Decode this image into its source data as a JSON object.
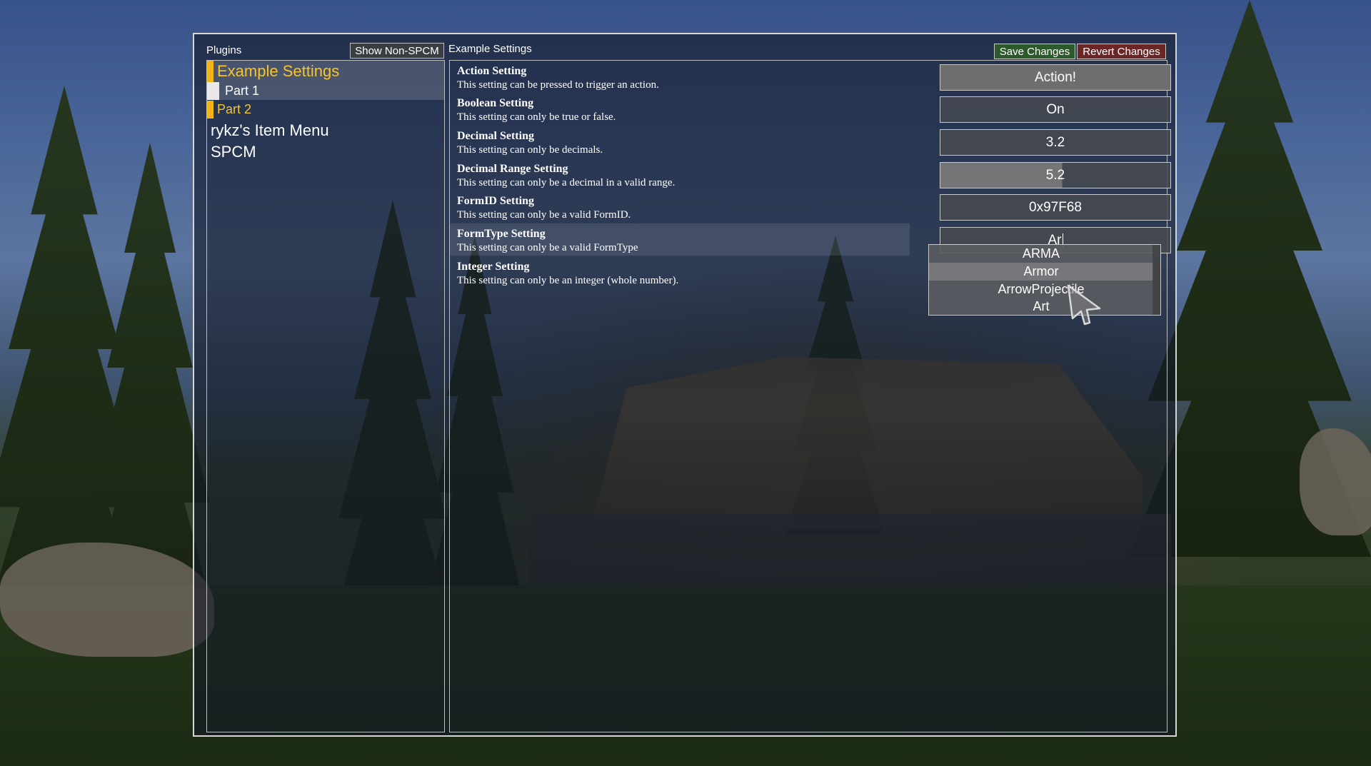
{
  "plugins_panel": {
    "title": "Plugins",
    "show_non_spcm_label": "Show Non-SPCM",
    "items": [
      {
        "label": "Example Settings",
        "selected": true
      },
      {
        "label": "Part 1"
      },
      {
        "label": "Part 2"
      },
      {
        "label": "rykz's Item Menu"
      },
      {
        "label": "SPCM"
      }
    ]
  },
  "settings_panel": {
    "title": "Example Settings",
    "save_label": "Save Changes",
    "revert_label": "Revert Changes",
    "settings": [
      {
        "name": "Action Setting",
        "description": "This setting can be pressed to trigger an action.",
        "value": "Action!"
      },
      {
        "name": "Boolean Setting",
        "description": "This setting can only be true or false.",
        "value": "On"
      },
      {
        "name": "Decimal Setting",
        "description": "This setting can only be decimals.",
        "value": "3.2"
      },
      {
        "name": "Decimal Range Setting",
        "description": "This setting can only be a decimal in a valid range.",
        "value": "5.2"
      },
      {
        "name": "FormID Setting",
        "description": "This setting can only be a valid FormID.",
        "value": "0x97F68"
      },
      {
        "name": "FormType Setting",
        "description": "This setting can only be a valid FormType",
        "value": "Ar"
      },
      {
        "name": "Integer Setting",
        "description": "This setting can only be an integer (whole number)."
      }
    ],
    "formtype_dropdown": {
      "options": [
        "ARMA",
        "Armor",
        "ArrowProjectile",
        "Art"
      ],
      "hovered": "Armor"
    }
  },
  "colors": {
    "accent_yellow": "#f1b51a",
    "save_green": "#2d5a2d",
    "revert_red": "#6b2626",
    "border": "#c8c8c8"
  },
  "icons": {
    "cursor": "arrow-cursor-icon"
  }
}
